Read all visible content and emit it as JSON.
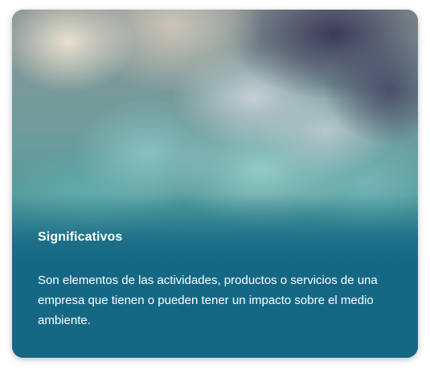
{
  "card": {
    "title": "Significativos",
    "description": "Son elementos de las actividades, productos o servicios de una empresa que tienen o pueden tener un impacto sobre el medio ambiente."
  },
  "colors": {
    "panel": "#156884",
    "text": "#ffffff"
  }
}
